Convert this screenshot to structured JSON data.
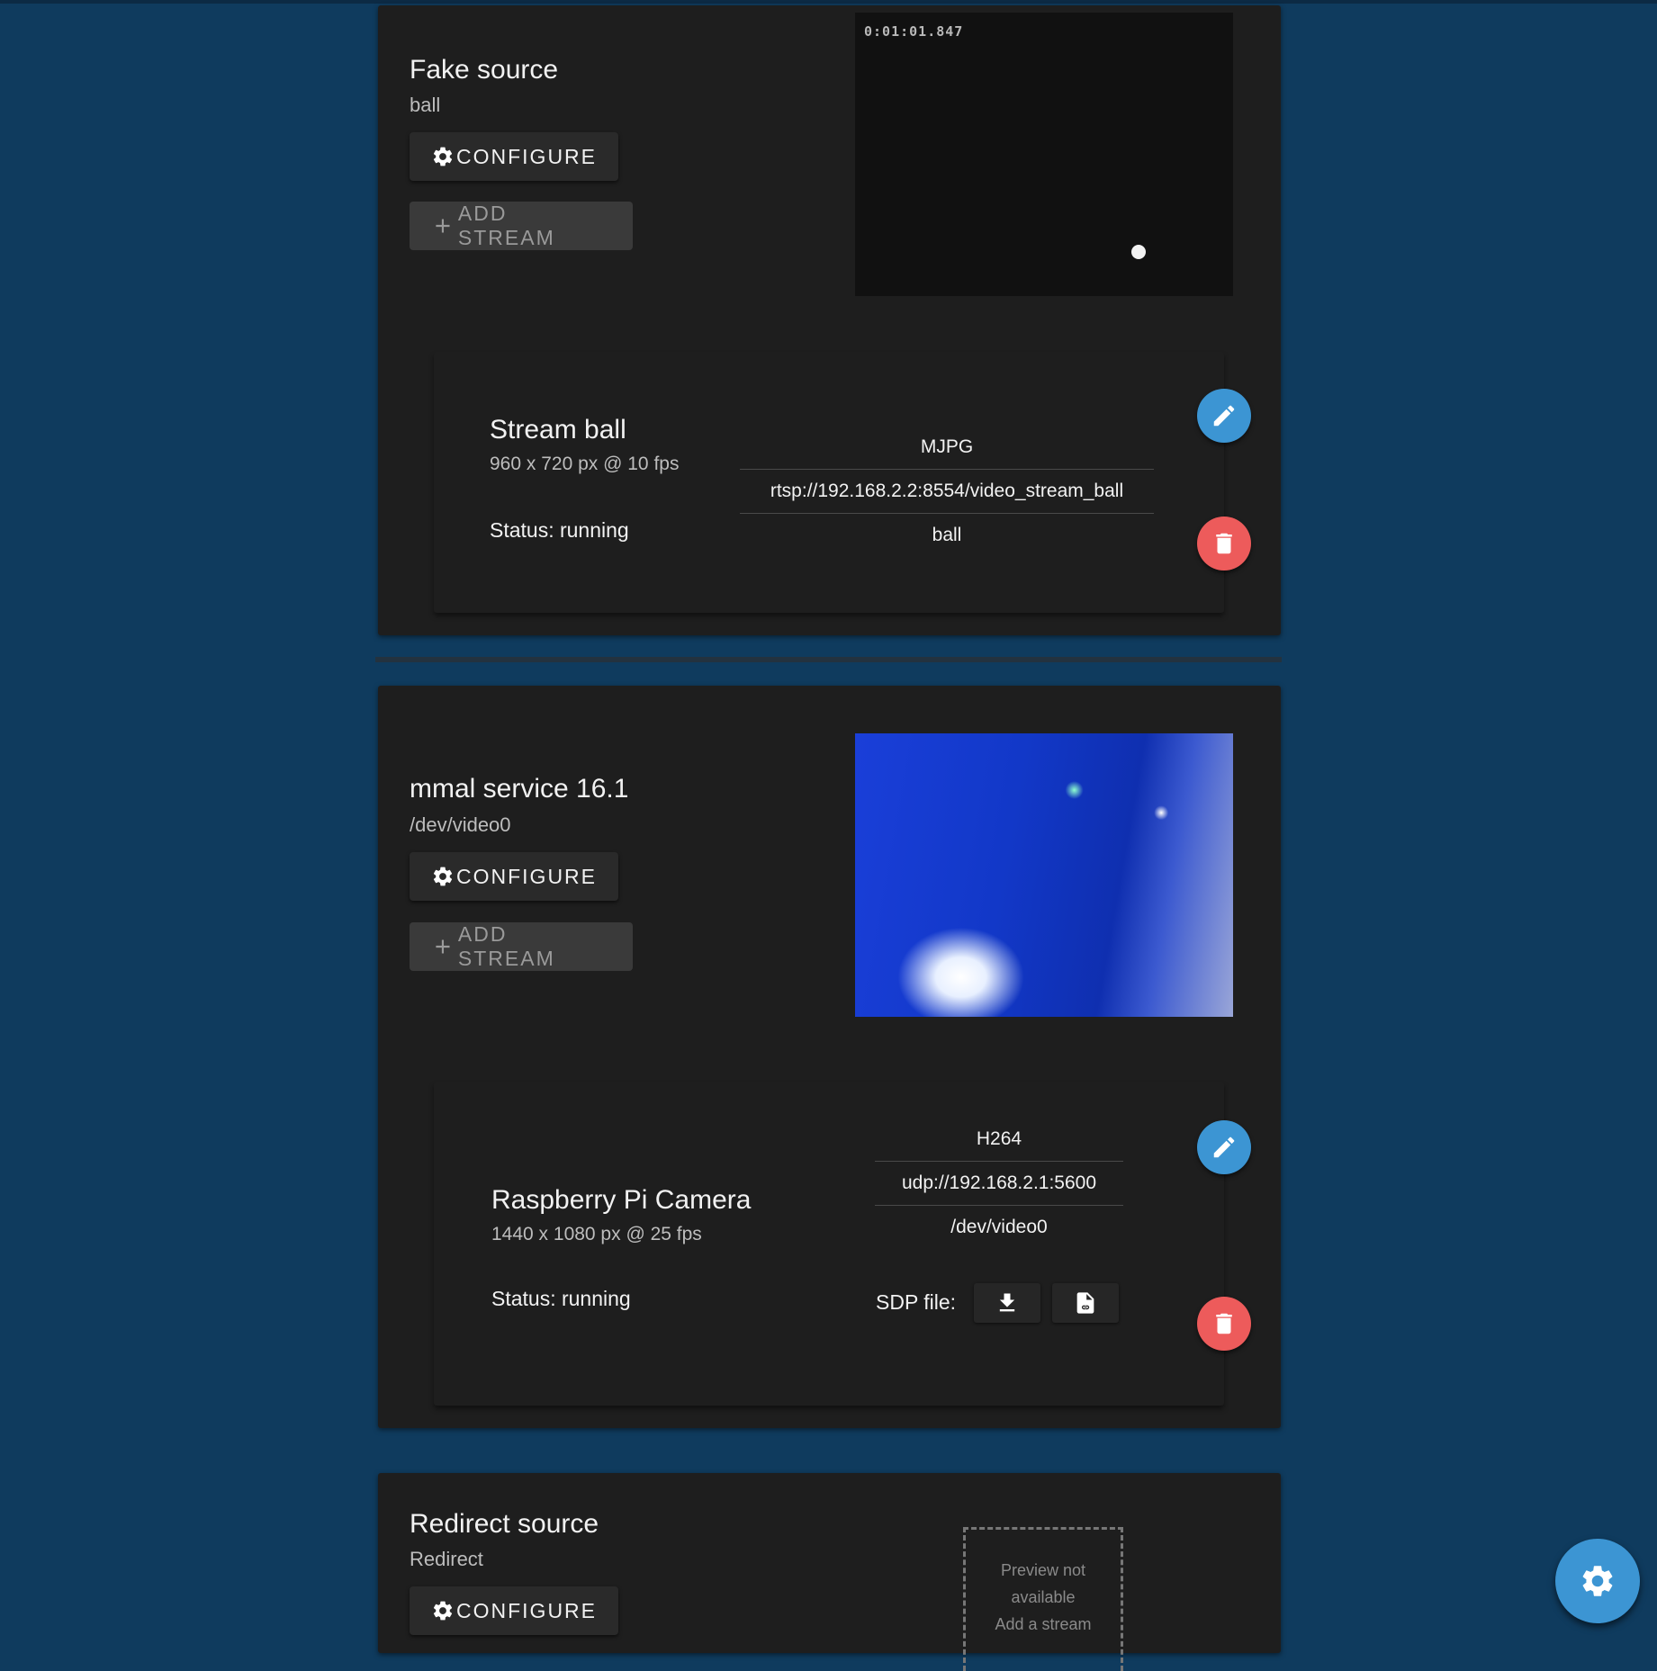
{
  "sources": [
    {
      "title": "Fake source",
      "subtitle": "ball",
      "configure_label": "CONFIGURE",
      "add_stream_label": "ADD STREAM",
      "preview_timestamp": "0:01:01.847",
      "stream": {
        "title": "Stream ball",
        "info": "960 x 720 px @ 10 fps",
        "status": "Status: running",
        "encode": "MJPG",
        "endpoint": "rtsp://192.168.2.2:8554/video_stream_ball",
        "name": "ball"
      }
    },
    {
      "title": "mmal service 16.1",
      "subtitle": "/dev/video0",
      "configure_label": "CONFIGURE",
      "add_stream_label": "ADD STREAM",
      "stream": {
        "title": "Raspberry Pi Camera",
        "info": "1440 x 1080 px @ 25 fps",
        "status": "Status: running",
        "encode": "H264",
        "endpoint": "udp://192.168.2.1:5600",
        "name": "/dev/video0",
        "sdp_label": "SDP file:"
      }
    },
    {
      "title": "Redirect source",
      "subtitle": "Redirect",
      "configure_label": "CONFIGURE",
      "preview_line1": "Preview not",
      "preview_line2": "available",
      "preview_line3": "Add a stream"
    }
  ],
  "colors": {
    "page_background": "#0f3b5e",
    "card_background": "#1e1e1e",
    "edit_button": "#3c95d3",
    "delete_button": "#ed5b5b",
    "settings_fab": "#3c95d3"
  },
  "icons": {
    "configure": "gear-icon",
    "add_stream": "plus-icon",
    "edit": "pencil-icon",
    "delete": "trash-icon",
    "sdp_download": "download-icon",
    "sdp_link": "file-link-icon",
    "settings": "gear-icon"
  }
}
